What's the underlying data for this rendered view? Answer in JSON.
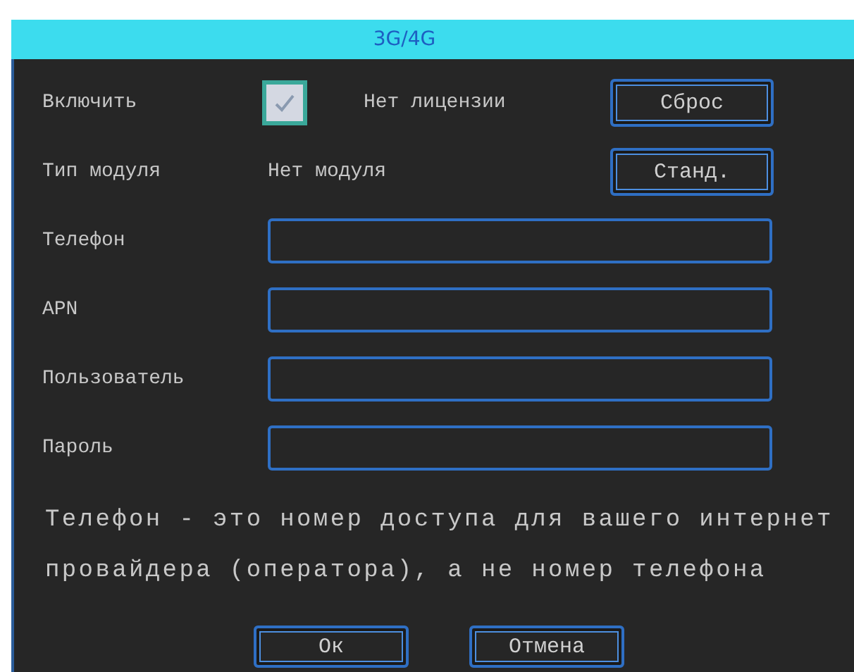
{
  "window": {
    "title": "3G/4G"
  },
  "rows": [
    {
      "kind": "toggle",
      "label": "Включить",
      "checked": true,
      "status": "Нет лицензии",
      "button": "Сброс"
    },
    {
      "kind": "info",
      "label": "Тип модуля",
      "value": "Нет модуля",
      "button": "Станд."
    },
    {
      "kind": "field",
      "label": "Телефон"
    },
    {
      "kind": "field",
      "label": "APN"
    },
    {
      "kind": "field",
      "label": "Пользователь"
    },
    {
      "kind": "field",
      "label": "Пароль"
    }
  ],
  "note": [
    "Телефон - это номер доступа для вашего интернет",
    "провайдера (оператора), а не номер телефона"
  ],
  "buttons": [
    "Ок",
    "Отмена"
  ]
}
